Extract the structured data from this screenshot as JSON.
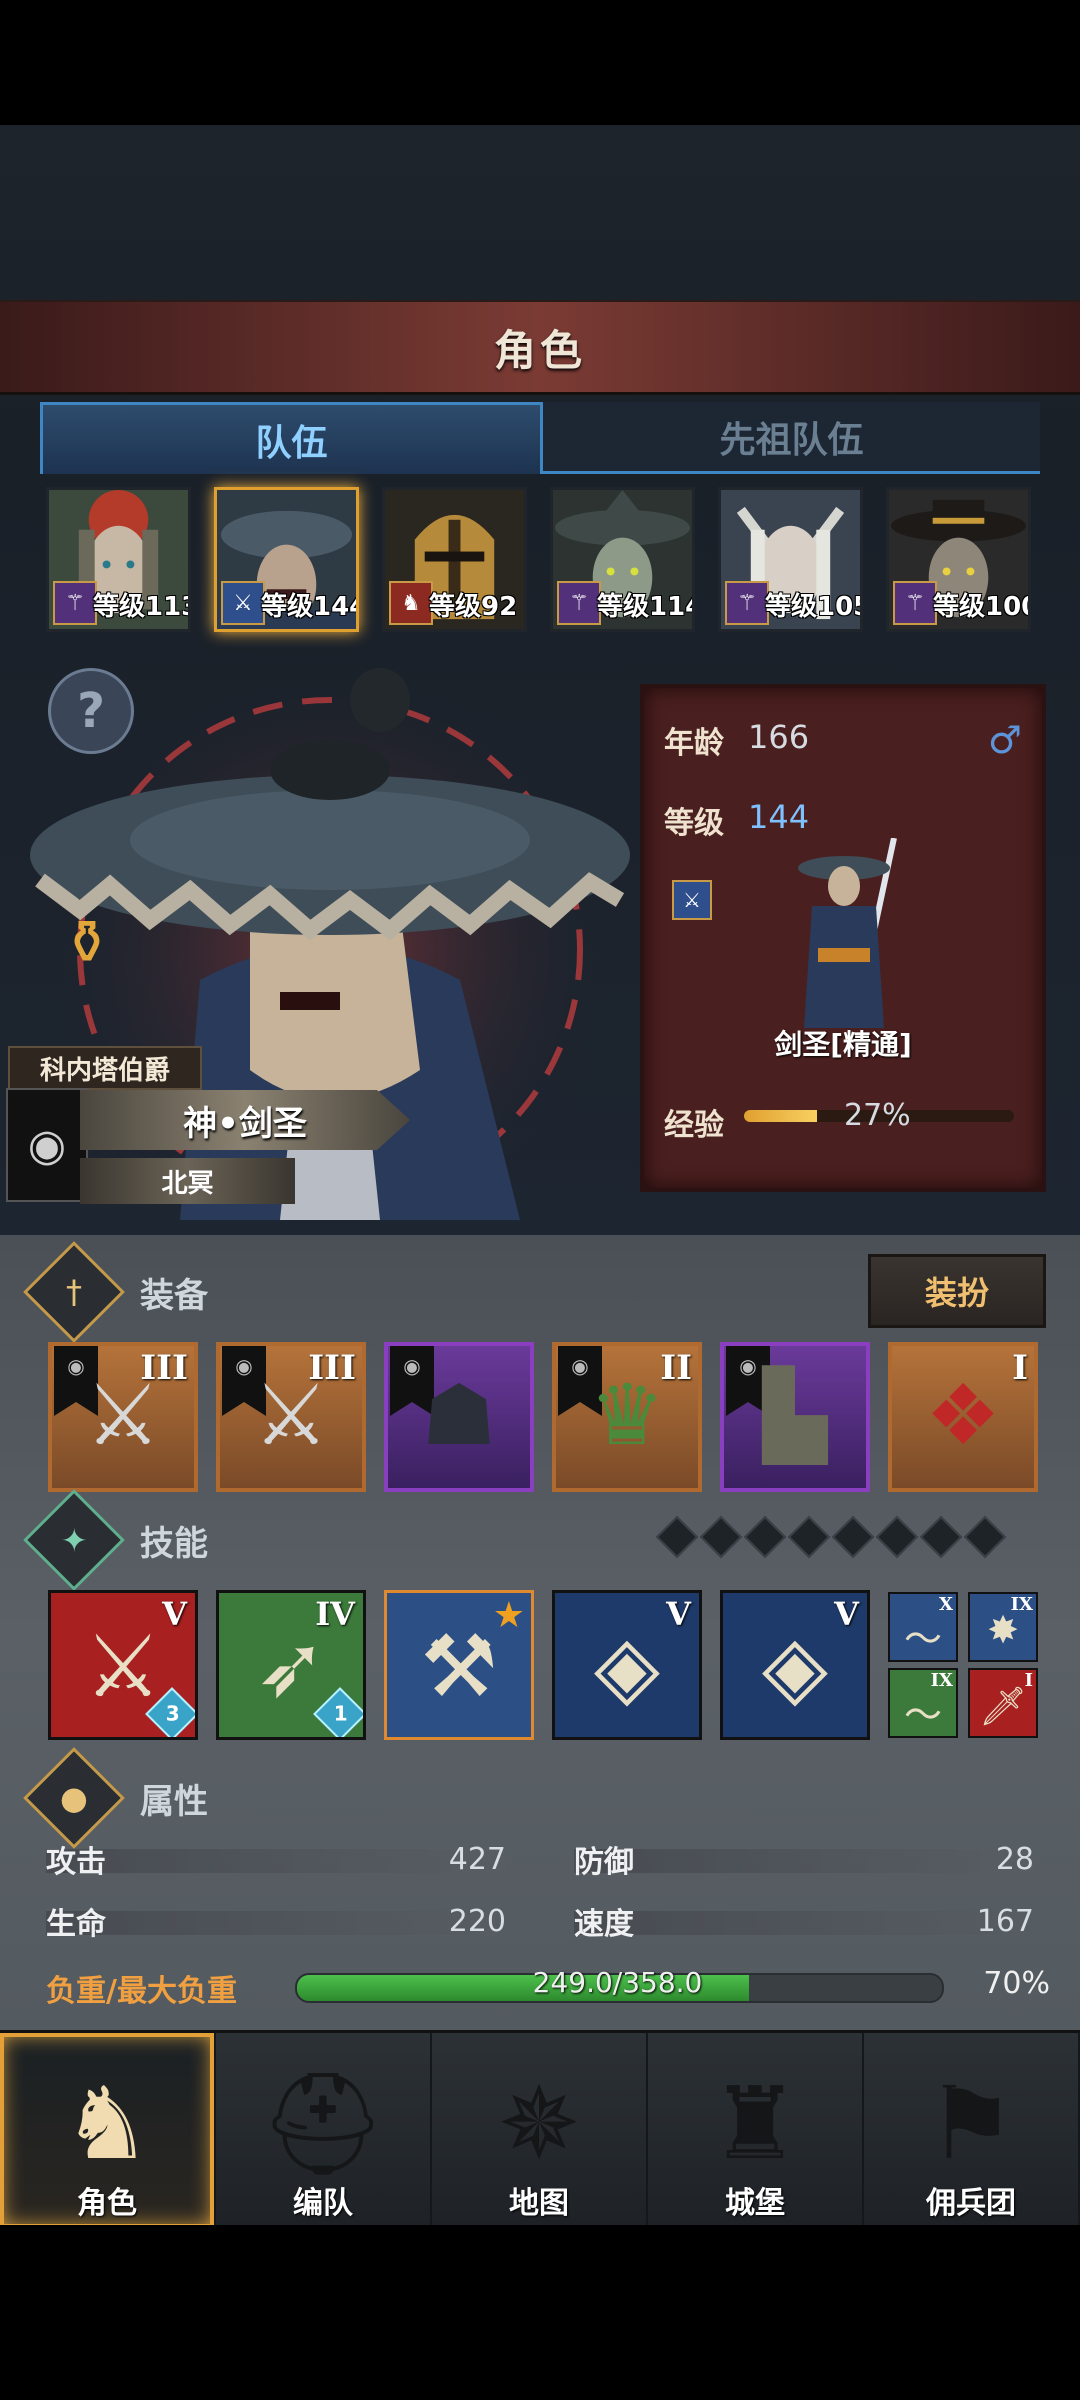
{
  "header": {
    "title": "角色"
  },
  "tabs": [
    {
      "label": "队伍",
      "active": true
    },
    {
      "label": "先祖队伍",
      "active": false
    }
  ],
  "party": [
    {
      "level_text": "等级113",
      "class_color": "#52307a",
      "selected": false
    },
    {
      "level_text": "等级144",
      "class_color": "#2f4f8c",
      "selected": true
    },
    {
      "level_text": "等级92",
      "class_color": "#8c2a22",
      "selected": false
    },
    {
      "level_text": "等级114",
      "class_color": "#52307a",
      "selected": false
    },
    {
      "level_text": "等级105",
      "class_color": "#52307a",
      "selected": false
    },
    {
      "level_text": "等级100",
      "class_color": "#52307a",
      "selected": false
    }
  ],
  "hero": {
    "title": "科内塔伯爵",
    "name": "神•剑圣",
    "region": "北冥"
  },
  "info": {
    "age_label": "年龄",
    "age_value": "166",
    "gender_symbol": "♂",
    "level_label": "等级",
    "level_value": "144",
    "class_name": "剑圣[精通]",
    "exp_label": "经验",
    "exp_percent": "27%",
    "exp_fraction": 0.27
  },
  "equipment": {
    "title": "装备",
    "outfit_button": "装扮",
    "items": [
      {
        "rank": "III",
        "rarity": "orange",
        "icon": "halberd-icon"
      },
      {
        "rank": "III",
        "rarity": "orange",
        "icon": "halberd-icon"
      },
      {
        "rank": "",
        "rarity": "purple",
        "icon": "hood-icon"
      },
      {
        "rank": "II",
        "rarity": "orange",
        "icon": "armor-icon"
      },
      {
        "rank": "",
        "rarity": "purple",
        "icon": "boots-icon"
      },
      {
        "rank": "I",
        "rarity": "orange",
        "icon": "knot-charm-icon"
      }
    ]
  },
  "skills": {
    "title": "技能",
    "slots_empty": 8,
    "items": [
      {
        "rank": "V",
        "bg": "#a82020",
        "badge": "3",
        "icon": "slash-icon"
      },
      {
        "rank": "IV",
        "bg": "#3b7a3a",
        "badge": "1",
        "icon": "strike-icon"
      },
      {
        "rank": "",
        "bg": "#2c4f86",
        "badge": "",
        "star": true,
        "icon": "sword-break-icon"
      },
      {
        "rank": "V",
        "bg": "#1e3a6a",
        "badge": "",
        "icon": "crystal-sword-icon"
      },
      {
        "rank": "V",
        "bg": "#1e3a6a",
        "badge": "",
        "icon": "crystal-strike-icon"
      }
    ],
    "passives": [
      {
        "rank": "X",
        "bg": "#2c4f86",
        "icon": "wind-icon"
      },
      {
        "rank": "IX",
        "bg": "#2c4f86",
        "icon": "burst-icon"
      },
      {
        "rank": "IX",
        "bg": "#3b7a3a",
        "icon": "wind-icon"
      },
      {
        "rank": "I",
        "bg": "#a82020",
        "icon": "sword-icon"
      }
    ]
  },
  "attributes": {
    "title": "属性",
    "stats": [
      {
        "label": "攻击",
        "value": "427"
      },
      {
        "label": "防御",
        "value": "28"
      },
      {
        "label": "生命",
        "value": "220"
      },
      {
        "label": "速度",
        "value": "167"
      }
    ],
    "load_label": "负重/最大负重",
    "load_text": "249.0/358.0",
    "load_percent": "70%",
    "load_fraction": 0.7
  },
  "nav": [
    {
      "label": "角色",
      "icon": "knight-icon",
      "active": true
    },
    {
      "label": "编队",
      "icon": "helmet-icon",
      "active": false
    },
    {
      "label": "地图",
      "icon": "compass-map-icon",
      "active": false
    },
    {
      "label": "城堡",
      "icon": "castle-icon",
      "active": false
    },
    {
      "label": "佣兵团",
      "icon": "mercenary-icon",
      "active": false
    }
  ]
}
